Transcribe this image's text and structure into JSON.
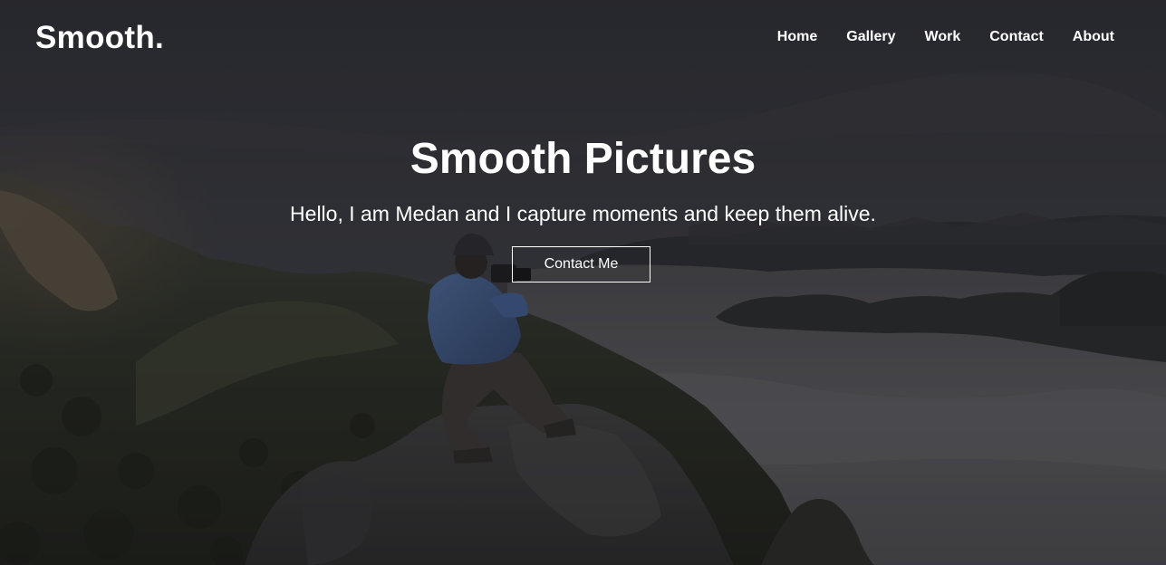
{
  "brand": {
    "logo_text": "Smooth."
  },
  "nav": {
    "items": [
      {
        "label": "Home"
      },
      {
        "label": "Gallery"
      },
      {
        "label": "Work"
      },
      {
        "label": "Contact"
      },
      {
        "label": "About"
      }
    ]
  },
  "hero": {
    "title": "Smooth Pictures",
    "subtitle": "Hello, I am Medan and I capture moments and keep them alive.",
    "cta_label": "Contact Me",
    "background_image": "photographer-on-mountain-rock-above-sea-of-clouds"
  },
  "colors": {
    "text": "#ffffff",
    "sky": "#34353a",
    "mountain_dark": "#1f2219",
    "jacket": "#3f5a85",
    "cloud": "#5a5a5c"
  }
}
